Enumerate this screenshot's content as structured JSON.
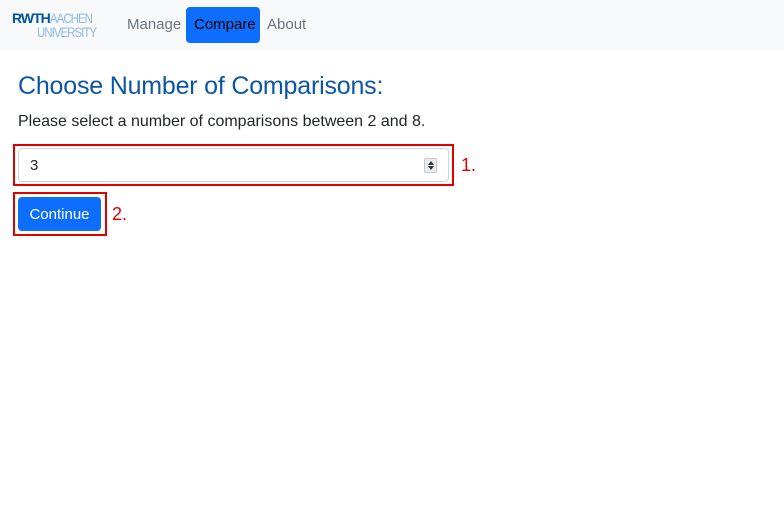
{
  "navbar": {
    "logo": {
      "line1_bold": "RWTH",
      "line1_light": "AACHEN",
      "line2": "UNIVERSITY",
      "colors": {
        "primary": "#00549f",
        "secondary": "#8ebae5"
      }
    },
    "items": [
      {
        "label": "Manage",
        "active": false
      },
      {
        "label": "Compare",
        "active": true
      },
      {
        "label": "About",
        "active": false
      }
    ]
  },
  "main": {
    "title": "Choose Number of Comparisons:",
    "instruction": "Please select a number of comparisons between 2 and 8.",
    "comparisons_input": {
      "value": "3",
      "min": 2,
      "max": 8
    },
    "continue_label": "Continue"
  },
  "annotations": [
    {
      "label": "1.",
      "target": "comparisons_input"
    },
    {
      "label": "2.",
      "target": "continue_button"
    }
  ],
  "colors": {
    "accent": "#0d6efd",
    "title": "#0b57a4",
    "annotation": "#e00000",
    "navbar_bg": "#f8f9fa"
  }
}
